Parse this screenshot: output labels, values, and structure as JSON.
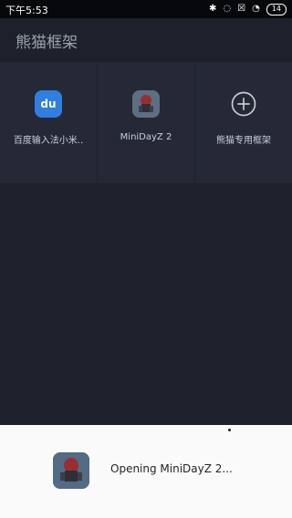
{
  "status": {
    "time": "下午5:53",
    "icons": [
      "bluetooth-icon",
      "notification-muted-icon",
      "close-box-icon",
      "wifi-icon"
    ],
    "battery": "14"
  },
  "header": {
    "title": "熊猫框架"
  },
  "apps": [
    {
      "label": "百度输入法小米..",
      "icon": "baidu-input-icon"
    },
    {
      "label": "MiniDayZ 2",
      "icon": "minidayz-icon"
    },
    {
      "label": "熊猫专用框架",
      "icon": "plus-circle-icon"
    }
  ],
  "bottom_sheet": {
    "message": "Opening MiniDayZ 2..."
  }
}
